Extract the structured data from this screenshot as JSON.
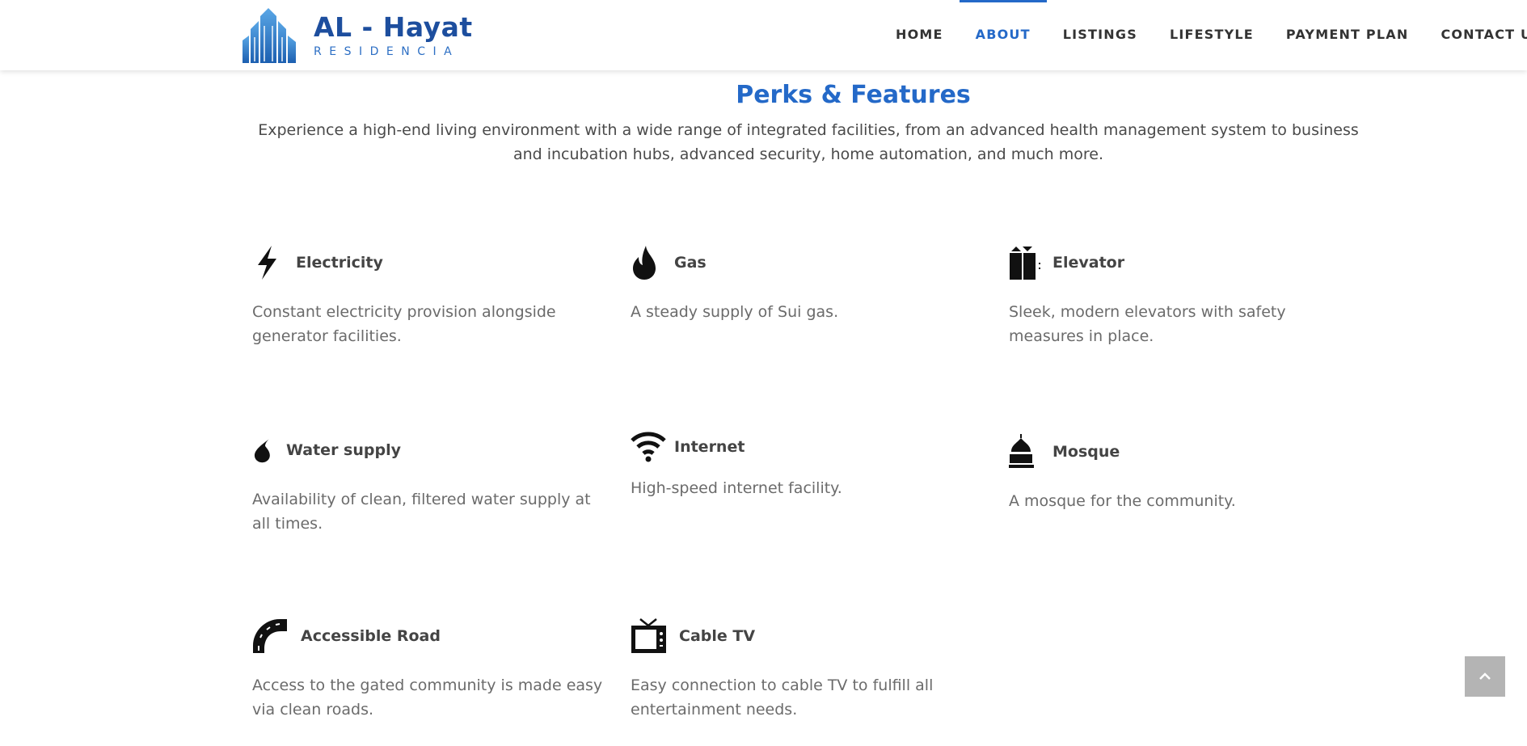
{
  "brand": {
    "title": "AL - Hayat",
    "subtitle": "RESIDENCIA",
    "logo_icon": "buildings-logo-icon",
    "color": "#1d4e9e"
  },
  "nav": {
    "items": [
      {
        "label": "HOME",
        "active": false
      },
      {
        "label": "ABOUT",
        "active": true
      },
      {
        "label": "LISTINGS",
        "active": false
      },
      {
        "label": "LIFESTYLE",
        "active": false
      },
      {
        "label": "PAYMENT PLAN",
        "active": false
      },
      {
        "label": "CONTACT US",
        "active": false
      }
    ],
    "active_color": "#2469c8"
  },
  "section": {
    "title": "Perks & Features",
    "intro": "Experience a high-end living environment with a wide range of integrated facilities, from an advanced health management system to business and incubation hubs, advanced security, home automation, and much more."
  },
  "features": [
    {
      "icon": "lightning-bolt-icon",
      "title": "Electricity",
      "description": "Constant electricity provision alongside generator facilities."
    },
    {
      "icon": "flame-icon",
      "title": "Gas",
      "description": "A steady supply of Sui gas."
    },
    {
      "icon": "elevator-icon",
      "title": "Elevator",
      "description": "Sleek, modern elevators with safety measures in place."
    },
    {
      "icon": "water-drop-icon",
      "title": "Water supply",
      "description": "Availability of clean, filtered water supply at all times."
    },
    {
      "icon": "wifi-icon",
      "title": "Internet",
      "description": "High-speed internet facility."
    },
    {
      "icon": "mosque-icon",
      "title": "Mosque",
      "description": "A mosque for the community."
    },
    {
      "icon": "road-icon",
      "title": "Accessible Road",
      "description": "Access to the gated community is made easy via clean roads."
    },
    {
      "icon": "tv-icon",
      "title": "Cable TV",
      "description": "Easy connection to cable TV to fulfill all entertainment needs."
    }
  ],
  "scroll_top": {
    "icon": "chevron-up-icon"
  }
}
